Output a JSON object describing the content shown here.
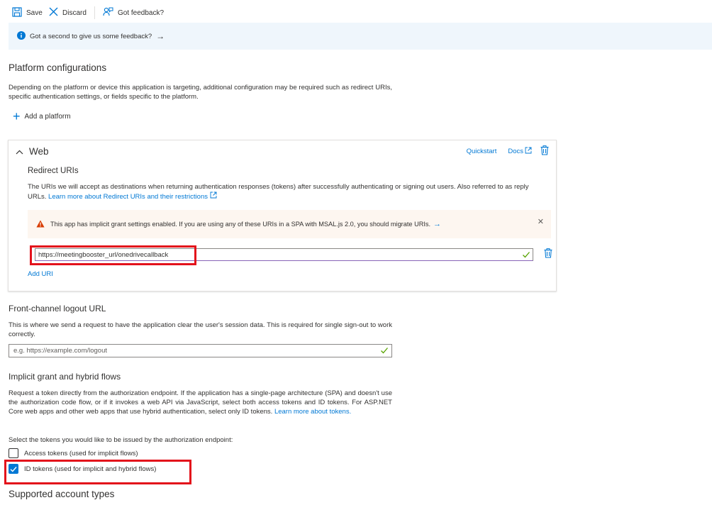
{
  "toolbar": {
    "save_label": "Save",
    "discard_label": "Discard",
    "feedback_label": "Got feedback?"
  },
  "banner": {
    "text": "Got a second to give us some feedback?",
    "arrow": "→"
  },
  "platform": {
    "title": "Platform configurations",
    "description": "Depending on the platform or device this application is targeting, additional configuration may be required such as redirect URIs, specific authentication settings, or fields specific to the platform.",
    "add_label": "Add a platform"
  },
  "web": {
    "title": "Web",
    "quickstart_label": "Quickstart",
    "docs_label": "Docs",
    "redirect_title": "Redirect URIs",
    "redirect_description": "The URIs we will accept as destinations when returning authentication responses (tokens) after successfully authenticating or signing out users. Also referred to as reply URLs.",
    "learn_more_label": "Learn more about Redirect URIs and their restrictions",
    "warning_text": "This app has implicit grant settings enabled. If you are using any of these URIs in a SPA with MSAL.js 2.0, you should migrate URIs.",
    "warning_arrow": "→",
    "close_glyph": "✕",
    "uri_value": "https://meetingbooster_url/onedrivecallback",
    "add_uri_label": "Add URI"
  },
  "logout": {
    "title": "Front-channel logout URL",
    "description": "This is where we send a request to have the application clear the user's session data. This is required for single sign-out to work correctly.",
    "placeholder": "e.g. https://example.com/logout"
  },
  "implicit": {
    "title": "Implicit grant and hybrid flows",
    "description": "Request a token directly from the authorization endpoint. If the application has a single-page architecture (SPA) and doesn't use the authorization code flow, or if it invokes a web API via JavaScript, select both access tokens and ID tokens. For ASP.NET Core web apps and other web apps that use hybrid authentication, select only ID tokens.",
    "learn_more_label": "Learn more about tokens.",
    "select_label": "Select the tokens you would like to be issued by the authorization endpoint:",
    "access_tokens_label": "Access tokens (used for implicit flows)",
    "access_tokens_checked": false,
    "id_tokens_label": "ID tokens (used for implicit and hybrid flows)",
    "id_tokens_checked": true
  },
  "account": {
    "title": "Supported account types"
  },
  "colors": {
    "accent": "#0078d4",
    "highlight": "#e3121b",
    "warning_bg": "#fdf6f0",
    "banner_bg": "#eff6fc"
  }
}
